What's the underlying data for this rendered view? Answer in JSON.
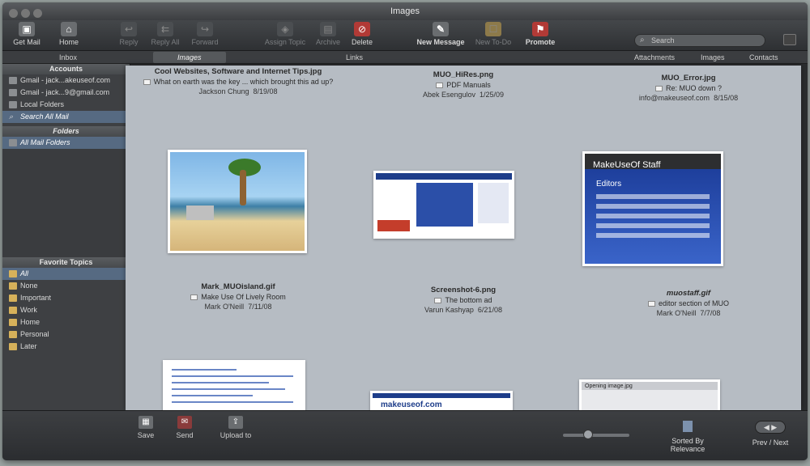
{
  "window": {
    "title": "Images"
  },
  "toolbar": {
    "buttons": [
      {
        "label": "Get Mail",
        "icon": "inbox-icon",
        "glyph": "▣"
      },
      {
        "label": "Home",
        "icon": "home-icon",
        "glyph": "⌂"
      },
      {
        "label": "Reply",
        "icon": "reply-icon",
        "glyph": "↩"
      },
      {
        "label": "Reply All",
        "icon": "reply-all-icon",
        "glyph": "⇇"
      },
      {
        "label": "Forward",
        "icon": "forward-icon",
        "glyph": "↪"
      },
      {
        "label": "Assign Topic",
        "icon": "tag-icon",
        "glyph": "◈"
      },
      {
        "label": "Archive",
        "icon": "archive-icon",
        "glyph": "▤"
      },
      {
        "label": "Delete",
        "icon": "delete-icon",
        "glyph": "⊘"
      },
      {
        "label": "New Message",
        "icon": "pen-icon",
        "glyph": "✎"
      },
      {
        "label": "New To-Do",
        "icon": "note-icon",
        "glyph": "☐"
      },
      {
        "label": "Promote",
        "icon": "flag-icon",
        "glyph": "⚑"
      }
    ],
    "search_placeholder": "Search"
  },
  "tabs": {
    "inbox": "Inbox",
    "images": "Images",
    "links": "Links",
    "attachments": "Attachments",
    "images_right": "Images",
    "contacts": "Contacts"
  },
  "sidebar": {
    "accounts_header": "Accounts",
    "accounts": [
      "Gmail - jack...akeuseof.com",
      "Gmail - jack...9@gmail.com",
      "Local Folders",
      "Search All Mail"
    ],
    "folders_header": "Folders",
    "folders": [
      "All Mail Folders"
    ],
    "topics_header": "Favorite Topics",
    "topics": [
      "All",
      "None",
      "Important",
      "Work",
      "Home",
      "Personal",
      "Later"
    ]
  },
  "grid": [
    {
      "file": "Cool Websites, Software and Internet Tips.jpg",
      "subject": "What on earth was the key ... which brought this ad up?",
      "sender": "Jackson Chung",
      "date": "8/19/08"
    },
    {
      "file": "MUO_HiRes.png",
      "subject": "PDF Manuals",
      "sender": "Abek Esengulov",
      "date": "1/25/09"
    },
    {
      "file": "MUO_Error.jpg",
      "subject": "Re: MUO down ?",
      "sender": "info@makeuseof.com",
      "date": "8/15/08"
    },
    {
      "file": "Mark_MUOisland.gif",
      "subject": "Make Use Of Lively Room",
      "sender": "Mark O'Neill",
      "date": "7/11/08"
    },
    {
      "file": "Screenshot-6.png",
      "subject": "The bottom ad",
      "sender": "Varun Kashyap",
      "date": "6/21/08"
    },
    {
      "file": "muostaff.gif",
      "subject": "editor section of MUO",
      "sender": "Mark O'Neill",
      "date": "7/7/08"
    }
  ],
  "thumbs": {
    "staff_title": "MakeUseOf Staff",
    "staff_sub": "Editors",
    "muo_logo": "makeuseof.com",
    "dialog_title": "Opening image.jpg"
  },
  "statusbar": {
    "save": "Save",
    "send": "Send",
    "upload": "Upload to",
    "sort": "Sorted By Relevance",
    "prev_next": "Prev / Next"
  },
  "zoom_level": 0.35
}
